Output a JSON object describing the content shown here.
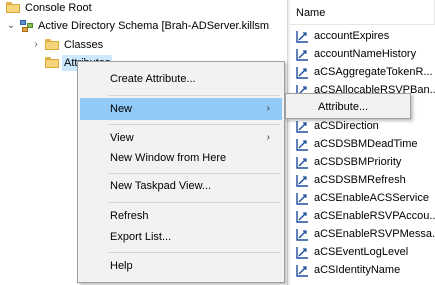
{
  "tree": {
    "root_label": "Console Root",
    "schema_label": "Active Directory Schema [Brah-ADServer.killsm",
    "classes_label": "Classes",
    "attributes_label": "Attributes"
  },
  "list": {
    "column_header": "Name",
    "items": [
      "accountExpires",
      "accountNameHistory",
      "aCSAggregateTokenR...",
      "aCSAllocableRSVPBan...",
      "aCSCacheTimeout",
      "aCSDirection",
      "aCSDSBMDeadTime",
      "aCSDSBMPriority",
      "aCSDSBMRefresh",
      "aCSEnableACSService",
      "aCSEnableRSVPAccou...",
      "aCSEnableRSVPMessa...",
      "aCSEventLogLevel",
      "aCSIdentityName"
    ]
  },
  "context_menu": {
    "create_attribute": "Create Attribute...",
    "new": "New",
    "view": "View",
    "new_window": "New Window from Here",
    "new_taskpad": "New Taskpad View...",
    "refresh": "Refresh",
    "export_list": "Export List...",
    "help": "Help"
  },
  "submenu": {
    "attribute": "Attribute..."
  },
  "colors": {
    "menu_hover": "#91c9f7",
    "tree_selection": "#cce8ff",
    "menu_background": "#f2f2f2"
  }
}
